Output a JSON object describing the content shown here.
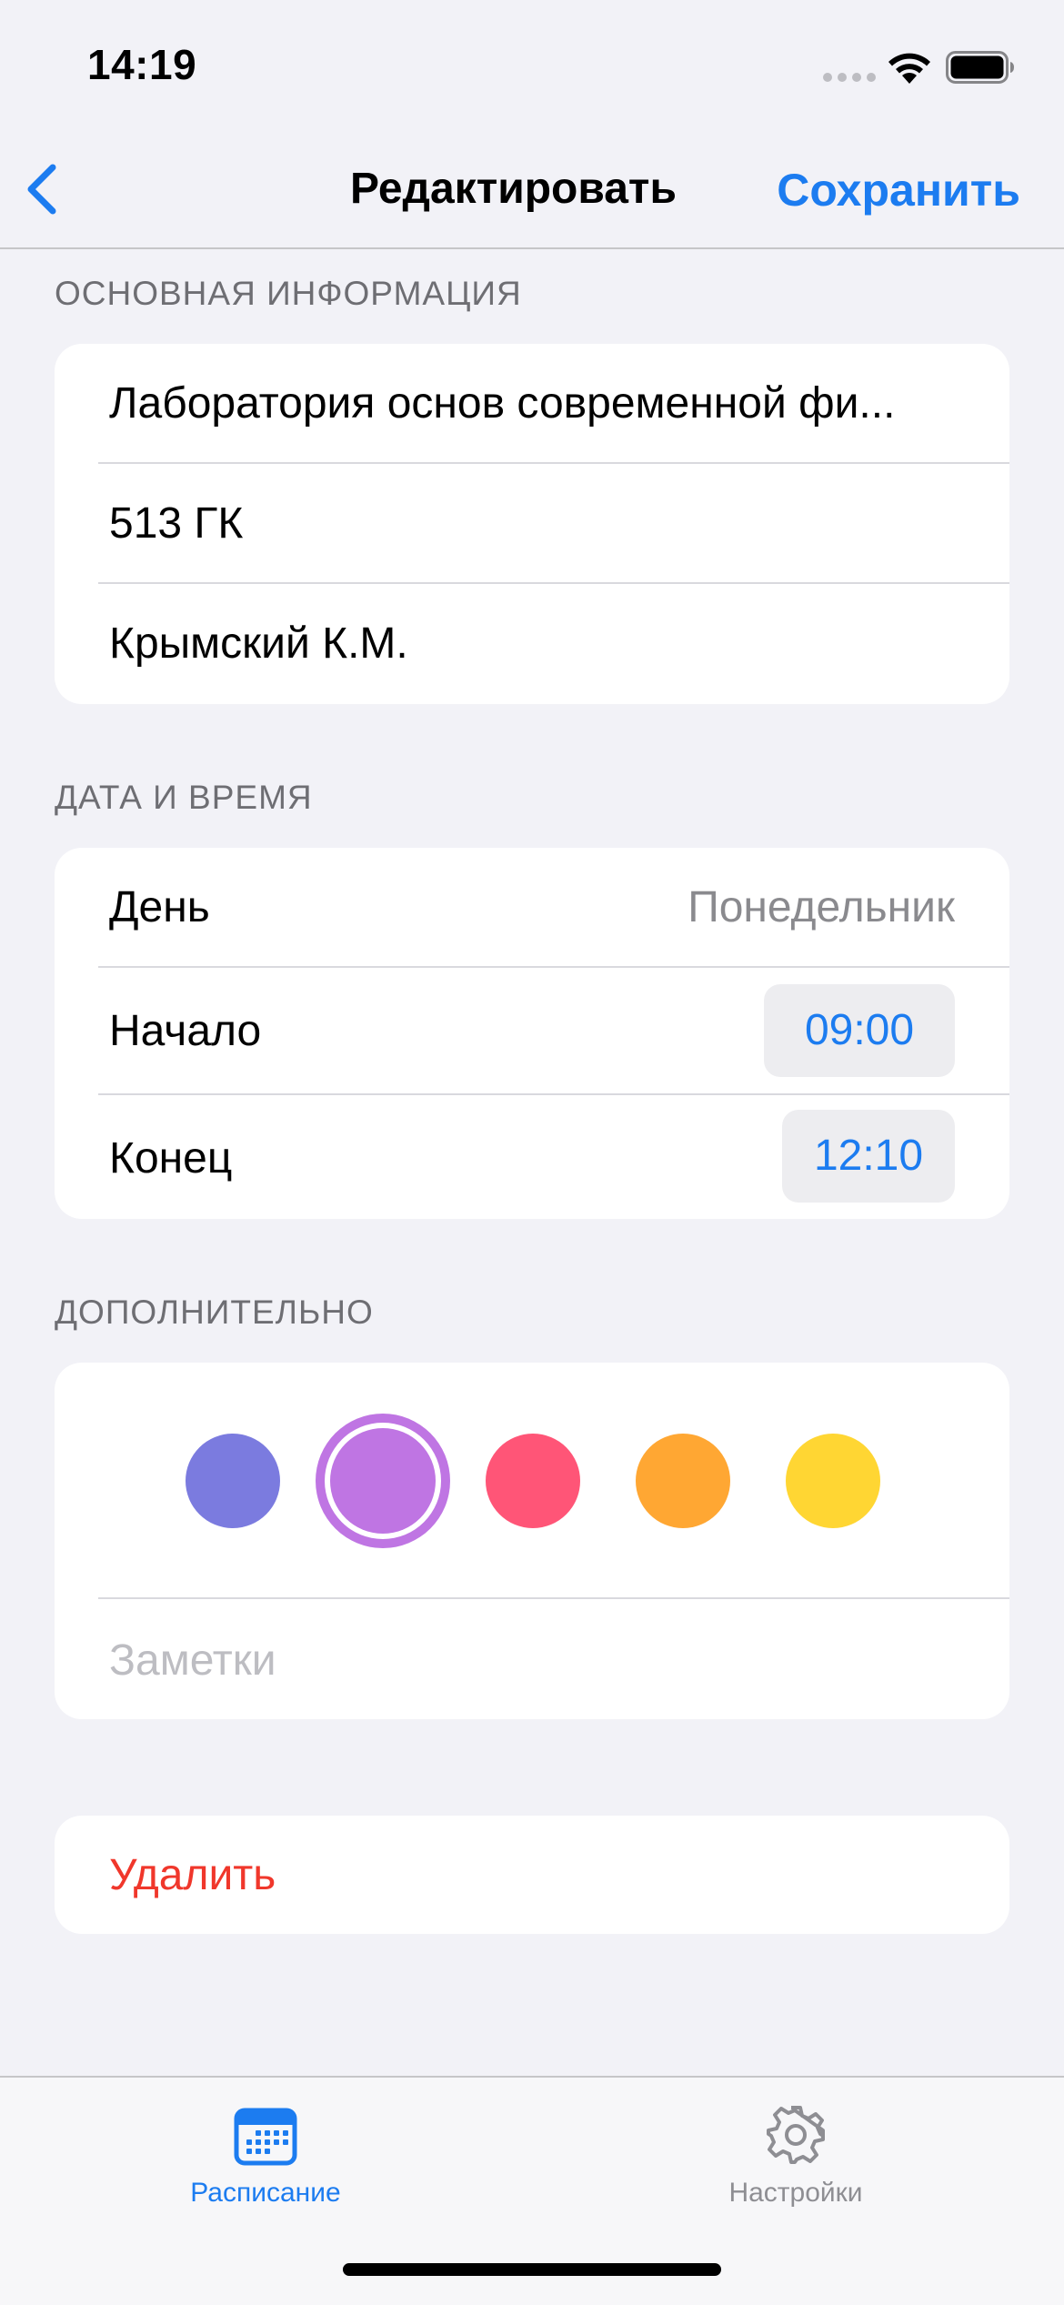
{
  "status_bar": {
    "time": "14:19"
  },
  "nav": {
    "title": "Редактировать",
    "save_label": "Сохранить",
    "accent_color": "#1C7CF0"
  },
  "basic_info": {
    "header": "ОСНОВНАЯ ИНФОРМАЦИЯ",
    "subject": "Лаборатория основ современной фи...",
    "room": "513 ГК",
    "teacher": "Крымский К.М."
  },
  "date_time": {
    "header": "ДАТА И ВРЕМЯ",
    "day_label": "День",
    "day_value": "Понедельник",
    "start_label": "Начало",
    "start_value": "09:00",
    "end_label": "Конец",
    "end_value": "12:10"
  },
  "extra": {
    "header": "ДОПОЛНИТЕЛЬНО",
    "colors": [
      "#7B7BDF",
      "#BF75E3",
      "#FF5577",
      "#FFA733",
      "#FFD633"
    ],
    "selected_color_index": 1,
    "notes_placeholder": "Заметки"
  },
  "delete": {
    "label": "Удалить",
    "color": "#F0372B"
  },
  "tab_bar": {
    "tabs": [
      {
        "label": "Расписание",
        "icon": "calendar-icon",
        "active": true
      },
      {
        "label": "Настройки",
        "icon": "gear-icon",
        "active": false
      }
    ]
  }
}
